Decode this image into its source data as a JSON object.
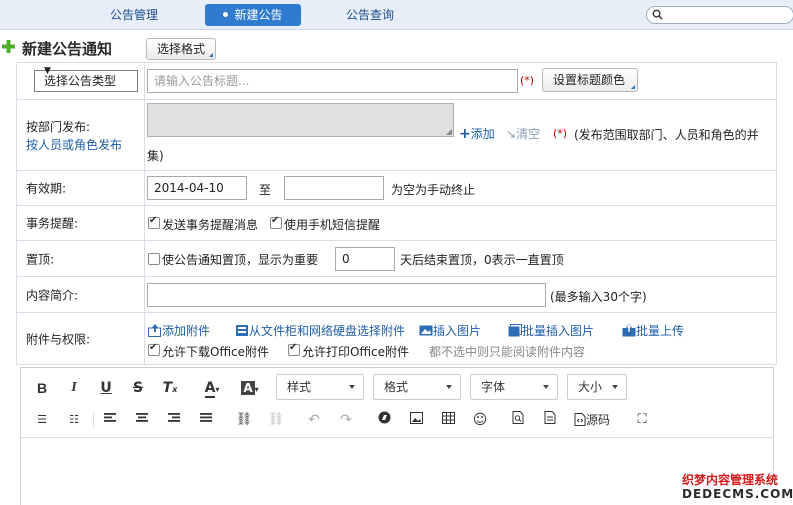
{
  "tabs": [
    {
      "label": "公告管理"
    },
    {
      "label": "新建公告"
    },
    {
      "label": "公告查询"
    }
  ],
  "page_title": "新建公告通知",
  "format_button": "选择格式",
  "notice": {
    "type_select": "选择公告类型",
    "title_placeholder": "请输入公告标题...",
    "required_mark": "(*)",
    "title_color_button": "设置标题颜色"
  },
  "publish": {
    "label": "按部门发布:",
    "alt_link": "按人员或角色发布",
    "add": "添加",
    "clear": "清空",
    "required_mark": "(*)",
    "note_line1": "(发布范围取部门、人员和角色的并",
    "note_line2": "集)"
  },
  "validity": {
    "label": "有效期:",
    "start": "2014-04-10",
    "to": "至",
    "end": "",
    "hint": "为空为手动终止"
  },
  "reminder": {
    "label": "事务提醒:",
    "option1": "发送事务提醒消息",
    "option2": "使用手机短信提醒"
  },
  "pin": {
    "label": "置顶:",
    "option": "使公告通知置顶，显示为重要",
    "days": "0",
    "hint": "天后结束置顶，0表示一直置顶"
  },
  "summary": {
    "label": "内容简介:",
    "value": "",
    "hint": "(最多输入30个字)"
  },
  "attach": {
    "label": "附件与权限:",
    "add": "添加附件",
    "from_disk": "从文件柜和网络硬盘选择附件",
    "insert_image": "插入图片",
    "batch_insert": "批量插入图片",
    "batch_upload": "批量上传",
    "allow_download": "允许下载Office附件",
    "allow_print": "允许打印Office附件",
    "note": "都不选中则只能阅读附件内容"
  },
  "editor": {
    "style_dd": "样式",
    "format_dd": "格式",
    "font_dd": "字体",
    "size_dd": "大小",
    "source_label": "源码"
  },
  "watermark": {
    "line1": "织梦内容管理系统",
    "line2": "DEDECMS.COM"
  }
}
